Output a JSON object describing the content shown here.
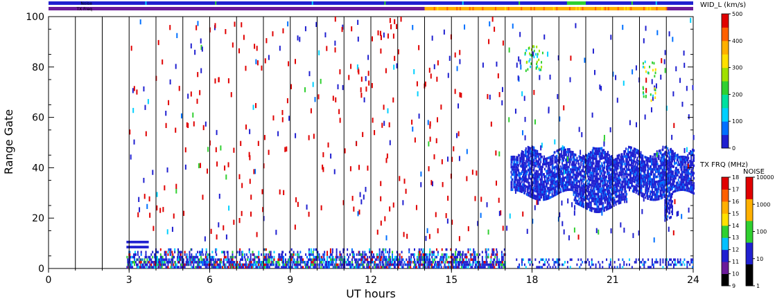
{
  "chart_data": {
    "type": "heatmap",
    "xlabel": "UT hours",
    "ylabel": "Range Gate",
    "xlim": [
      0,
      24
    ],
    "ylim": [
      0,
      100
    ],
    "x_ticks": [
      "0",
      "3",
      "6",
      "9",
      "12",
      "15",
      "18",
      "21",
      "24"
    ],
    "y_ticks": [
      "0",
      "20",
      "40",
      "60",
      "80",
      "100"
    ],
    "grid": "vertical lines every hour",
    "top_bars": [
      {
        "label": "Noise",
        "segments": [
          {
            "from": 0,
            "to": 24,
            "color": "#2020d0"
          },
          {
            "from": 19.3,
            "to": 20.0,
            "color": "#30d030"
          },
          {
            "from": 23.0,
            "to": 24.0,
            "color": "#2020d0"
          }
        ]
      },
      {
        "label": "TX Freq",
        "segments": [
          {
            "from": 0,
            "to": 14.0,
            "color": "#6a1a9a"
          },
          {
            "from": 14.0,
            "to": 23.0,
            "color": "#ffb000"
          },
          {
            "from": 23.0,
            "to": 24.0,
            "color": "#6a1a9a"
          }
        ]
      }
    ],
    "colorbars": [
      {
        "title": "WID_L (km/s)",
        "ticks": [
          "0",
          "100",
          "200",
          "300",
          "400",
          "500"
        ],
        "range": [
          0,
          500
        ],
        "colors": [
          "#2020d0",
          "#0070ff",
          "#00d0ff",
          "#00e0a0",
          "#30d030",
          "#a0e000",
          "#ffe000",
          "#ffb000",
          "#ff6000",
          "#e00000"
        ]
      },
      {
        "title": "TX FRQ (MHz)",
        "ticks": [
          "9",
          "10",
          "11",
          "12",
          "13",
          "14",
          "15",
          "16",
          "17",
          "18"
        ],
        "colors": [
          "#000000",
          "#6a1a9a",
          "#2020d0",
          "#00c0ff",
          "#30d030",
          "#ffe000",
          "#ffb000",
          "#ff6000",
          "#e00000"
        ]
      },
      {
        "title": "NOISE",
        "ticks": [
          "1",
          "10",
          "100",
          "1000",
          "10000"
        ],
        "colors": [
          "#000000",
          "#2020d0",
          "#30d030",
          "#ffb000",
          "#e00000"
        ]
      }
    ],
    "series": [
      {
        "region": "low-range echoes",
        "x_range": [
          2.9,
          17.0
        ],
        "y_range": [
          0,
          8
        ],
        "dominant_color": "#2020d0"
      },
      {
        "region": "low-range echoes",
        "x_range": [
          17.4,
          24.0
        ],
        "y_range": [
          0,
          4
        ],
        "dominant_color": "#2020d0"
      },
      {
        "region": "mid-range band",
        "x_range": [
          17.2,
          24.0
        ],
        "y_range": [
          22,
          48
        ],
        "dominant_color": "#2020d0"
      },
      {
        "region": "scattered echoes",
        "x_range": [
          3.0,
          24.0
        ],
        "y_range": [
          10,
          100
        ],
        "dominant_color": "#e00000"
      }
    ]
  }
}
